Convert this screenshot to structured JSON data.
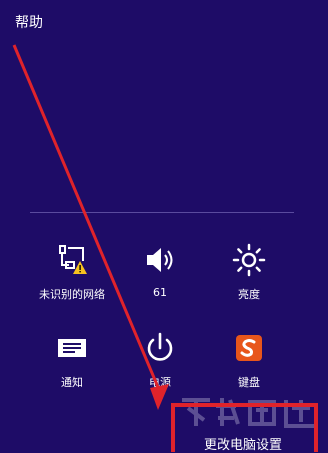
{
  "charm": {
    "title": "帮助",
    "tiles": [
      {
        "icon": "network-warning-icon",
        "label": "未识别的网络"
      },
      {
        "icon": "volume-icon",
        "label": "61"
      },
      {
        "icon": "brightness-icon",
        "label": "亮度"
      },
      {
        "icon": "notifications-icon",
        "label": "通知"
      },
      {
        "icon": "power-icon",
        "label": "电源"
      },
      {
        "icon": "sogou-keyboard-icon",
        "label": "键盘"
      }
    ],
    "footer_link": "更改电脑设置"
  },
  "colors": {
    "background": "#1e0c67",
    "annotation": "#e0232b",
    "warning": "#f7c21f",
    "keyboard_brand": "#e8561b"
  }
}
